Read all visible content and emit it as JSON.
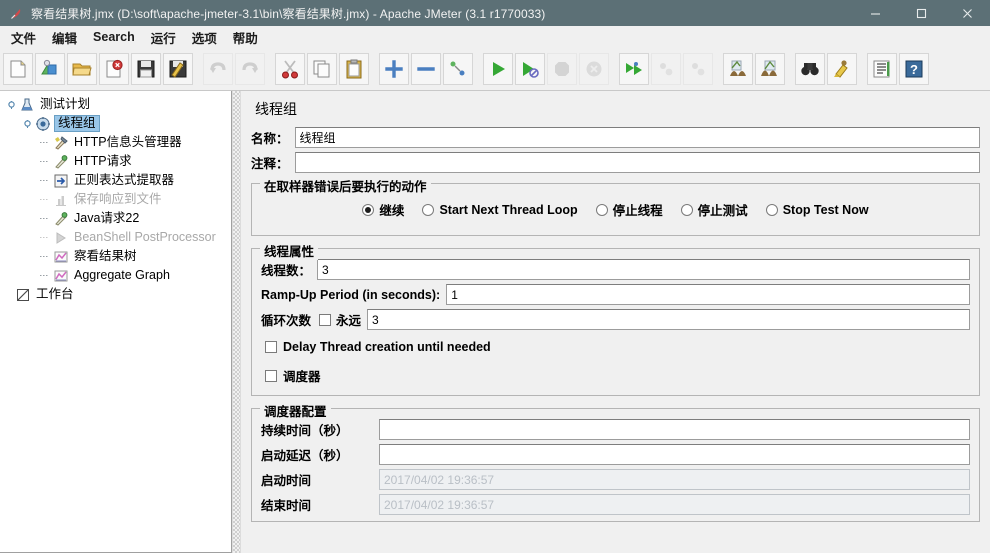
{
  "window": {
    "title": "察看结果树.jmx (D:\\soft\\apache-jmeter-3.1\\bin\\察看结果树.jmx) - Apache JMeter (3.1 r1770033)",
    "icon": "jmeter-feather-icon",
    "minimize_label": "minimize-icon",
    "maximize_label": "maximize-icon",
    "close_label": "close-icon",
    "titlebar_color": "#5c7076"
  },
  "menubar": {
    "items": [
      {
        "label": "文件",
        "name": "menu-file"
      },
      {
        "label": "编辑",
        "name": "menu-edit"
      },
      {
        "label": "Search",
        "name": "menu-search"
      },
      {
        "label": "运行",
        "name": "menu-run"
      },
      {
        "label": "选项",
        "name": "menu-options"
      },
      {
        "label": "帮助",
        "name": "menu-help"
      }
    ]
  },
  "toolbar": {
    "buttons": [
      {
        "icon": "new-document-icon",
        "enabled": true
      },
      {
        "icon": "templates-icon",
        "enabled": true
      },
      {
        "icon": "open-folder-icon",
        "enabled": true
      },
      {
        "icon": "close-document-icon",
        "enabled": true
      },
      {
        "icon": "save-icon",
        "enabled": true
      },
      {
        "icon": "save-as-icon",
        "enabled": true
      },
      {
        "separator": true
      },
      {
        "icon": "undo-icon",
        "enabled": false
      },
      {
        "icon": "redo-icon",
        "enabled": false
      },
      {
        "separator": true
      },
      {
        "icon": "cut-scissors-icon",
        "enabled": true
      },
      {
        "icon": "copy-icon",
        "enabled": true
      },
      {
        "icon": "paste-clipboard-icon",
        "enabled": true
      },
      {
        "separator": true
      },
      {
        "icon": "expand-plus-icon",
        "enabled": true
      },
      {
        "icon": "collapse-minus-icon",
        "enabled": true
      },
      {
        "icon": "toggle-node-icon",
        "enabled": true
      },
      {
        "separator": true
      },
      {
        "icon": "start-play-icon",
        "enabled": true
      },
      {
        "icon": "start-no-pauses-icon",
        "enabled": true
      },
      {
        "icon": "stop-icon",
        "enabled": false
      },
      {
        "icon": "shutdown-icon",
        "enabled": false
      },
      {
        "separator": true
      },
      {
        "icon": "remote-start-all-icon",
        "enabled": true
      },
      {
        "icon": "remote-stop-all-icon",
        "enabled": false
      },
      {
        "icon": "remote-shutdown-all-icon",
        "enabled": false
      },
      {
        "separator": true
      },
      {
        "icon": "clear-icon",
        "enabled": true
      },
      {
        "icon": "clear-all-icon",
        "enabled": true
      },
      {
        "separator": true
      },
      {
        "icon": "search-binoculars-icon",
        "enabled": true
      },
      {
        "icon": "reset-search-broom-icon",
        "enabled": true
      },
      {
        "separator": true
      },
      {
        "icon": "function-helper-icon",
        "enabled": true
      },
      {
        "icon": "help-book-icon",
        "enabled": true
      }
    ]
  },
  "tree": {
    "nodes": [
      {
        "label": "测试计划",
        "icon": "test-plan-icon",
        "depth": 0,
        "selected": false,
        "disabled": false,
        "expander": true
      },
      {
        "label": "线程组",
        "icon": "thread-group-icon",
        "depth": 1,
        "selected": true,
        "disabled": false,
        "expander": true
      },
      {
        "label": "HTTP信息头管理器",
        "icon": "header-manager-icon",
        "depth": 2,
        "selected": false,
        "disabled": false,
        "expander": false
      },
      {
        "label": "HTTP请求",
        "icon": "http-request-icon",
        "depth": 2,
        "selected": false,
        "disabled": false,
        "expander": false
      },
      {
        "label": "正则表达式提取器",
        "icon": "regex-extractor-icon",
        "depth": 2,
        "selected": false,
        "disabled": false,
        "expander": false
      },
      {
        "label": "保存响应到文件",
        "icon": "save-responses-icon",
        "depth": 2,
        "selected": false,
        "disabled": true,
        "expander": false
      },
      {
        "label": "Java请求22",
        "icon": "java-request-icon",
        "depth": 2,
        "selected": false,
        "disabled": false,
        "expander": false
      },
      {
        "label": "BeanShell PostProcessor",
        "icon": "beanshell-postprocessor-icon",
        "depth": 2,
        "selected": false,
        "disabled": true,
        "expander": false
      },
      {
        "label": "察看结果树",
        "icon": "view-results-tree-icon",
        "depth": 2,
        "selected": false,
        "disabled": false,
        "expander": false
      },
      {
        "label": "Aggregate Graph",
        "icon": "aggregate-graph-icon",
        "depth": 2,
        "selected": false,
        "disabled": false,
        "expander": false
      },
      {
        "label": "工作台",
        "icon": "workbench-icon",
        "depth": 0,
        "selected": false,
        "disabled": false,
        "expander": false
      }
    ]
  },
  "panel": {
    "title": "线程组",
    "name_label": "名称：",
    "name_value": "线程组",
    "comment_label": "注释：",
    "comment_value": "",
    "error_action": {
      "legend": "在取样器错误后要执行的动作",
      "options": [
        {
          "label": "继续",
          "selected": true
        },
        {
          "label": "Start Next Thread Loop",
          "selected": false
        },
        {
          "label": "停止线程",
          "selected": false
        },
        {
          "label": "停止测试",
          "selected": false
        },
        {
          "label": "Stop Test Now",
          "selected": false
        }
      ]
    },
    "thread_properties": {
      "legend": "线程属性",
      "threads_label": "线程数：",
      "threads_value": "3",
      "rampup_label": "Ramp-Up Period (in seconds):",
      "rampup_value": "1",
      "loop_label": "循环次数",
      "forever_label": "永远",
      "forever_checked": false,
      "loop_value": "3",
      "delay_create_label": "Delay Thread creation until needed",
      "delay_create_checked": false,
      "scheduler_label": "调度器",
      "scheduler_checked": false
    },
    "scheduler_config": {
      "legend": "调度器配置",
      "duration_label": "持续时间（秒）",
      "duration_value": "",
      "startup_delay_label": "启动延迟（秒）",
      "startup_delay_value": "",
      "start_time_label": "启动时间",
      "start_time_value": "2017/04/02 19:36:57",
      "end_time_label": "结束时间",
      "end_time_value": "2017/04/02 19:36:57"
    }
  }
}
